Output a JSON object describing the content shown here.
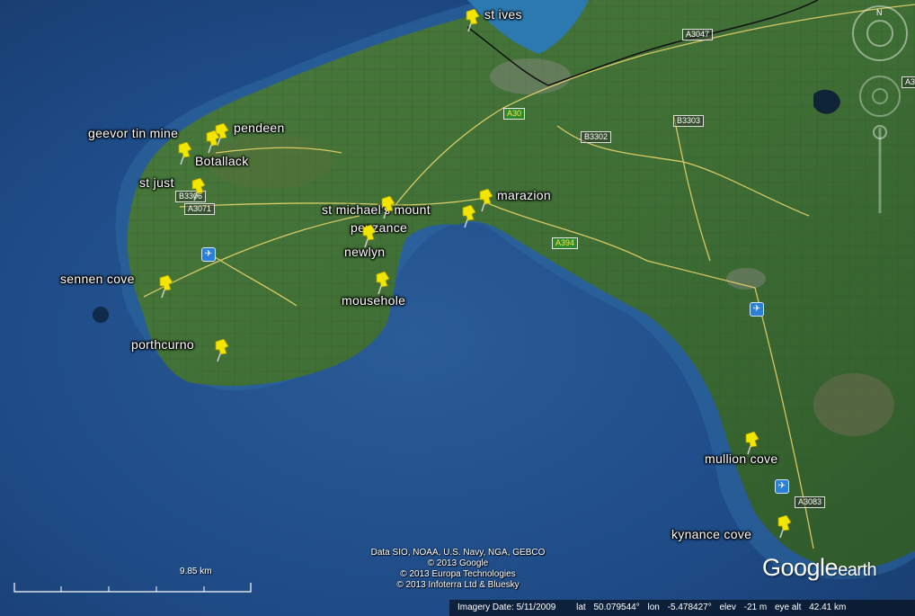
{
  "places": [
    {
      "name": "st ives"
    },
    {
      "name": "pendeen"
    },
    {
      "name": "geevor tin mine"
    },
    {
      "name": "Botallack"
    },
    {
      "name": "st just"
    },
    {
      "name": "st michael's mount"
    },
    {
      "name": "marazion"
    },
    {
      "name": "penzance"
    },
    {
      "name": "newlyn"
    },
    {
      "name": "mousehole"
    },
    {
      "name": "sennen cove"
    },
    {
      "name": "porthcurno"
    },
    {
      "name": "mullion cove"
    },
    {
      "name": "kynance cove"
    }
  ],
  "roads": [
    "A3047",
    "A30",
    "B3303",
    "B3302",
    "B3306",
    "A3071",
    "A394",
    "A3083",
    "A3"
  ],
  "credits": [
    "Data SIO, NOAA, U.S. Navy, NGA, GEBCO",
    "© 2013 Google",
    "© 2013 Europa Technologies",
    "© 2013 Infoterra Ltd & Bluesky"
  ],
  "scale_label": "9.85 km",
  "status": {
    "imagery_date": "Imagery Date: 5/11/2009",
    "lat_label": "lat",
    "lat": "50.079544°",
    "lon_label": "lon",
    "lon": "-5.478427°",
    "elev_label": "elev",
    "elev": "-21 m",
    "eye_alt_label": "eye alt",
    "eye_alt": "42.41 km"
  },
  "logo": {
    "google": "Google",
    "earth": "earth"
  },
  "colors": {
    "pin": "#f2e600",
    "sea": "#1f4c86",
    "land": "#3d6a34",
    "road": "#e8d36a",
    "rail": "#111111"
  }
}
